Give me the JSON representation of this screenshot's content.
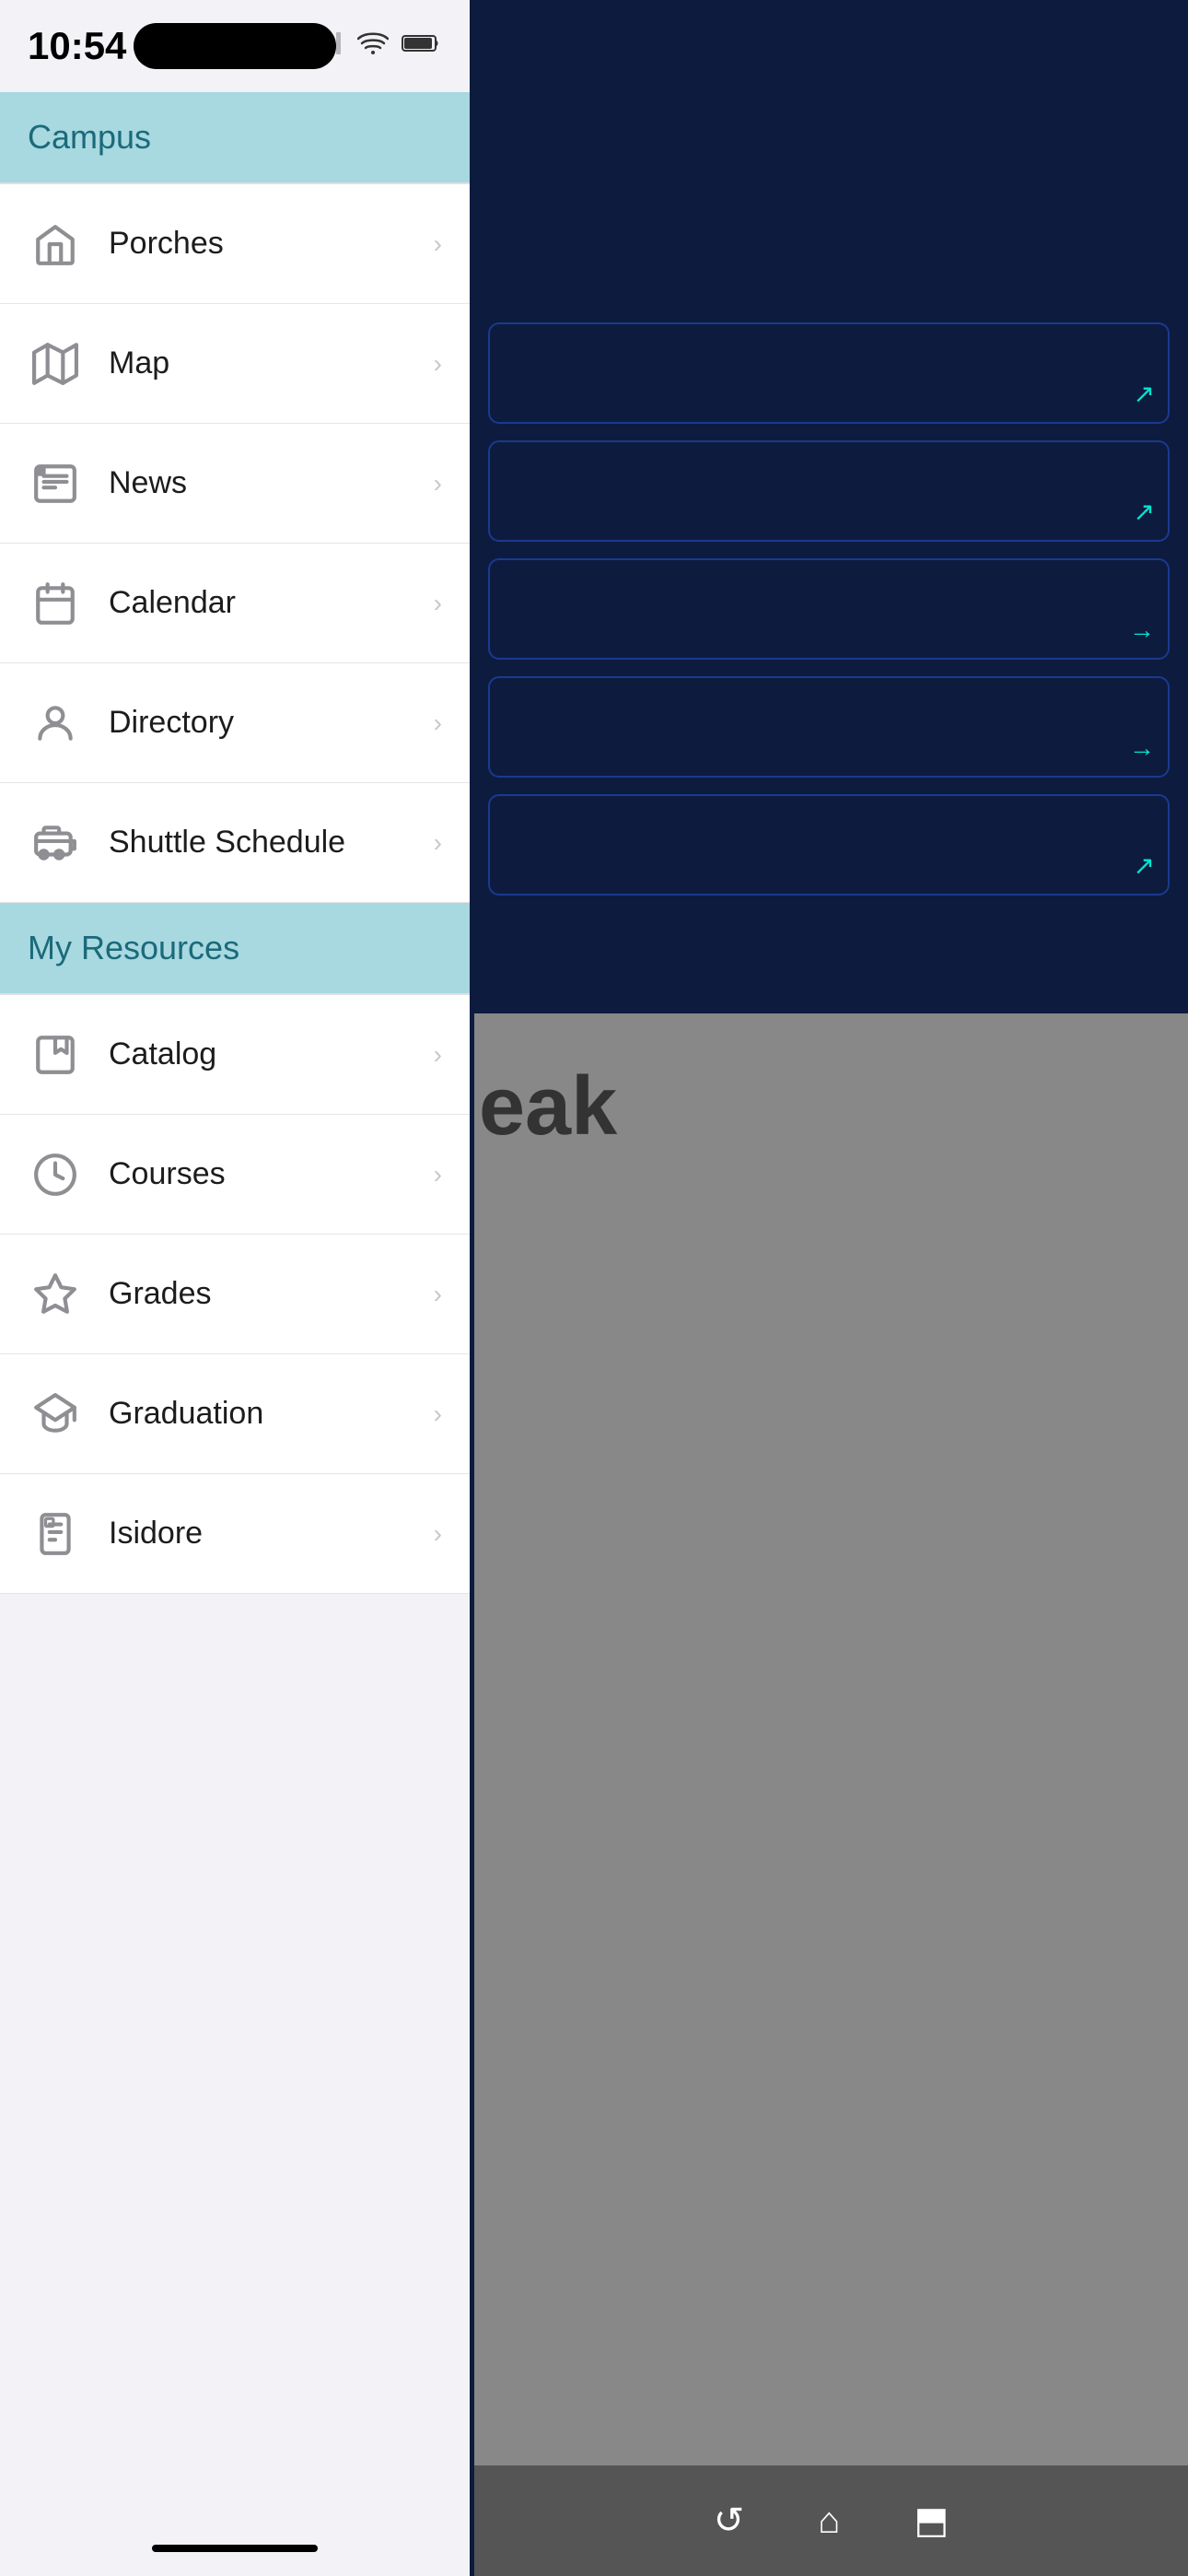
{
  "statusBar": {
    "time": "10:54",
    "pill": "dynamic-island"
  },
  "sections": [
    {
      "id": "campus",
      "label": "Campus",
      "items": [
        {
          "id": "porches",
          "label": "Porches",
          "icon": "home"
        },
        {
          "id": "map",
          "label": "Map",
          "icon": "map"
        },
        {
          "id": "news",
          "label": "News",
          "icon": "news"
        },
        {
          "id": "calendar",
          "label": "Calendar",
          "icon": "calendar"
        },
        {
          "id": "directory",
          "label": "Directory",
          "icon": "person"
        },
        {
          "id": "shuttle-schedule",
          "label": "Shuttle Schedule",
          "icon": "shuttle"
        }
      ]
    },
    {
      "id": "my-resources",
      "label": "My Resources",
      "items": [
        {
          "id": "catalog",
          "label": "Catalog",
          "icon": "catalog"
        },
        {
          "id": "courses",
          "label": "Courses",
          "icon": "courses"
        },
        {
          "id": "grades",
          "label": "Grades",
          "icon": "grades"
        },
        {
          "id": "graduation",
          "label": "Graduation",
          "icon": "graduation"
        },
        {
          "id": "isidore",
          "label": "Isidore",
          "icon": "isidore"
        }
      ]
    }
  ],
  "rightCards": [
    {
      "arrowType": "diagonal"
    },
    {
      "arrowType": "diagonal"
    },
    {
      "arrowType": "right"
    },
    {
      "arrowType": "right"
    },
    {
      "arrowType": "diagonal"
    }
  ],
  "partialText": "eak"
}
